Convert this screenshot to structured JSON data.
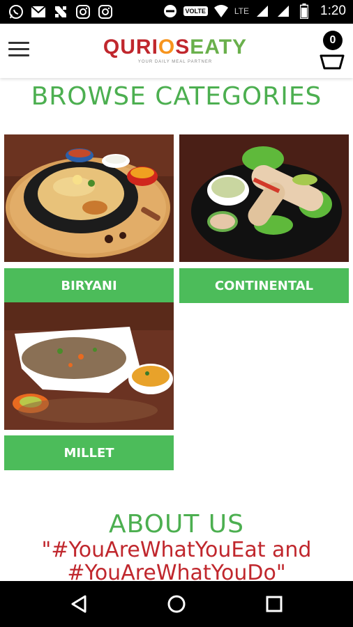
{
  "status_bar": {
    "time": "1:20",
    "volte": "VOLTE",
    "network": "LTE",
    "left_icons": [
      "whatsapp-icon",
      "gmail-icon",
      "news-icon",
      "instagram-icon",
      "instagram-icon"
    ]
  },
  "header": {
    "logo_q": "QURI",
    "logo_o": "O",
    "logo_s": "S",
    "logo_e": "EATY",
    "logo_tagline": "YOUR DAILY MEAL PARTNER",
    "cart_count": "0"
  },
  "browse": {
    "title": "BROWSE CATEGORIES",
    "categories": [
      {
        "label": "BIRYANI"
      },
      {
        "label": "CONTINENTAL"
      },
      {
        "label": "MILLET"
      }
    ]
  },
  "about": {
    "title": "ABOUT US",
    "tagline_line1": "\"#YouAreWhatYouEat and",
    "tagline_line2": "#YouAreWhatYouDo\""
  },
  "colors": {
    "brand_green": "#4cbc5a",
    "brand_red": "#c0272d",
    "brand_orange": "#f7941d"
  }
}
